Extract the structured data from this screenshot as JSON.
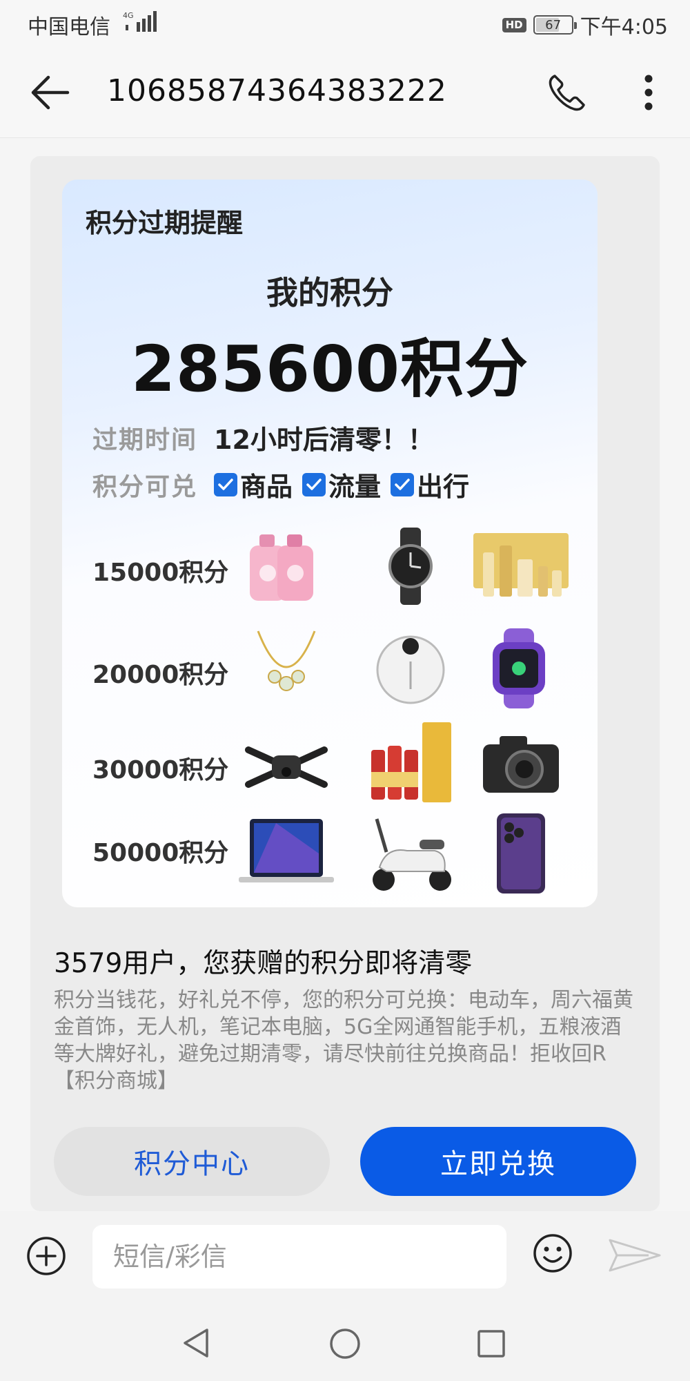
{
  "status_bar": {
    "carrier": "中国电信",
    "network": "4G",
    "hd": "HD",
    "battery": "67",
    "battery_fraction": 0.67,
    "time": "下午4:05"
  },
  "header": {
    "contact_number": "10685874364383222"
  },
  "poster": {
    "title": "积分过期提醒",
    "points_label": "我的积分",
    "points_value": "285600积分",
    "expiry_label": "过期时间",
    "expiry_value": "12小时后清零！！",
    "redeem_label": "积分可兑",
    "redeem_options": [
      "商品",
      "流量",
      "出行"
    ],
    "tiers": [
      {
        "label": "15000积分",
        "products": [
          "laundry-detergent-icon",
          "wristwatch-icon",
          "cosmetics-set-icon"
        ]
      },
      {
        "label": "20000积分",
        "products": [
          "necklace-icon",
          "robot-vacuum-icon",
          "kids-smartwatch-icon"
        ]
      },
      {
        "label": "30000积分",
        "products": [
          "drone-icon",
          "liquor-gift-icon",
          "camera-icon"
        ]
      },
      {
        "label": "50000积分",
        "products": [
          "laptop-icon",
          "electric-scooter-icon",
          "smartphone-icon"
        ]
      }
    ]
  },
  "message": {
    "heading": "3579用户，您获赠的积分即将清零",
    "body": "积分当钱花，好礼兑不停，您的积分可兑换：电动车，周六福黄金首饰，无人机，笔记本电脑，5G全网通智能手机，五粮液酒等大牌好礼，避免过期清零，请尽快前往兑换商品！拒收回R【积分商城】",
    "button_secondary": "积分中心",
    "button_primary": "立即兑换"
  },
  "input_bar": {
    "placeholder": "短信/彩信"
  },
  "colors": {
    "primary_button": "#0a5be6",
    "secondary_button_text": "#1f5bd6",
    "checkbox": "#1d6fe0"
  }
}
